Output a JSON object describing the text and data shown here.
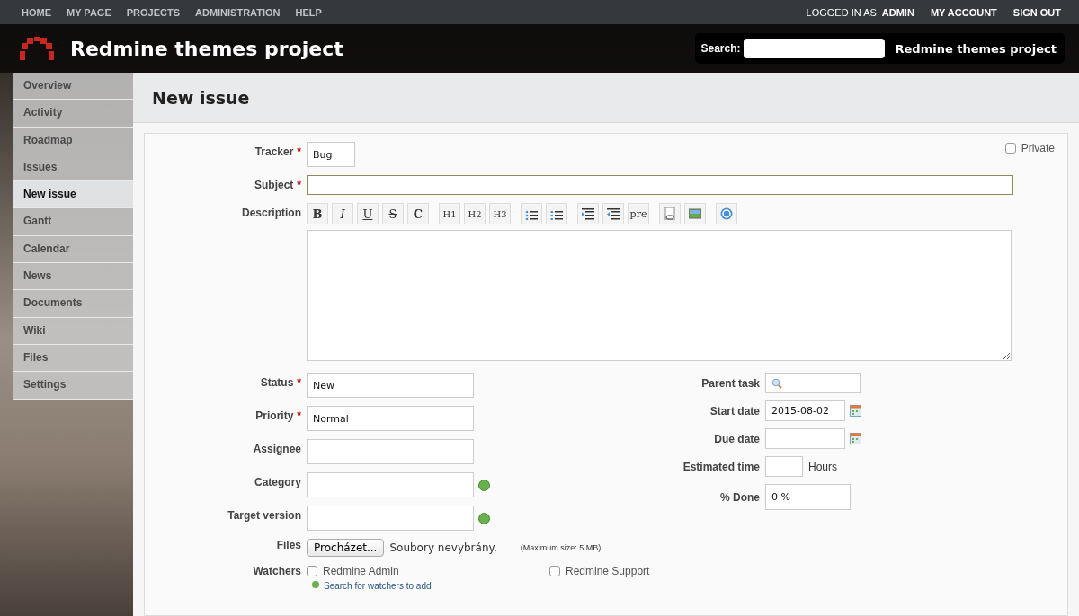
{
  "top_menu": {
    "left": [
      {
        "label": "HOME"
      },
      {
        "label": "MY PAGE"
      },
      {
        "label": "PROJECTS"
      },
      {
        "label": "ADMINISTRATION"
      },
      {
        "label": "HELP"
      }
    ],
    "logged_in_as": "LOGGED IN AS",
    "user": "ADMIN",
    "right": [
      {
        "label": "MY ACCOUNT"
      },
      {
        "label": "SIGN OUT"
      }
    ]
  },
  "header": {
    "title": "Redmine themes project",
    "search_label": "Search:",
    "project_jump": "Redmine themes project"
  },
  "sidebar": {
    "items": [
      {
        "label": "Overview",
        "selected": false
      },
      {
        "label": "Activity",
        "selected": false
      },
      {
        "label": "Roadmap",
        "selected": false
      },
      {
        "label": "Issues",
        "selected": false
      },
      {
        "label": "New issue",
        "selected": true
      },
      {
        "label": "Gantt",
        "selected": false
      },
      {
        "label": "Calendar",
        "selected": false
      },
      {
        "label": "News",
        "selected": false
      },
      {
        "label": "Documents",
        "selected": false
      },
      {
        "label": "Wiki",
        "selected": false
      },
      {
        "label": "Files",
        "selected": false
      },
      {
        "label": "Settings",
        "selected": false
      }
    ]
  },
  "page_title": "New issue",
  "form": {
    "tracker": {
      "label": "Tracker",
      "marker": "*",
      "value": "Bug"
    },
    "private": {
      "label": "Private",
      "checked": false
    },
    "subject": {
      "label": "Subject",
      "marker": "*"
    },
    "description": {
      "label": "Description",
      "toolbar": [
        [
          {
            "kind": "text",
            "label": "B"
          },
          {
            "kind": "text",
            "label": "I"
          },
          {
            "kind": "text",
            "label": "U"
          },
          {
            "kind": "text",
            "label": "S"
          },
          {
            "kind": "text",
            "label": "C"
          }
        ],
        [
          {
            "kind": "text",
            "label": "H1"
          },
          {
            "kind": "text",
            "label": "H2"
          },
          {
            "kind": "text",
            "label": "H3"
          }
        ],
        [
          {
            "kind": "icon"
          },
          {
            "kind": "icon"
          }
        ],
        [
          {
            "kind": "icon"
          },
          {
            "kind": "icon"
          },
          {
            "kind": "text",
            "label": "pre"
          }
        ],
        [
          {
            "kind": "icon"
          },
          {
            "kind": "icon"
          }
        ],
        [
          {
            "kind": "icon"
          }
        ]
      ]
    },
    "left": [
      {
        "label": "Status",
        "marker": "*",
        "value": "New"
      },
      {
        "label": "Priority",
        "marker": "*",
        "value": "Normal"
      },
      {
        "label": "Assignee"
      },
      {
        "label": "Category",
        "add": true
      },
      {
        "label": "Target version",
        "add": true
      }
    ],
    "right": [
      {
        "label": "Parent task",
        "kind": "search"
      },
      {
        "label": "Start date",
        "kind": "date",
        "value": "2015-08-02"
      },
      {
        "label": "Due date",
        "kind": "date"
      },
      {
        "label": "Estimated time",
        "kind": "hours",
        "unit": "Hours"
      },
      {
        "label": "% Done",
        "kind": "select",
        "value": "0 %"
      }
    ],
    "files": {
      "label": "Files",
      "button": "Procházet...",
      "status": "Soubory nevybrány.",
      "note": "(Maximum size: 5 MB)"
    },
    "watchers": {
      "label": "Watchers",
      "items": [
        {
          "label": "Redmine Admin",
          "checked": false
        },
        {
          "label": "Redmine Support",
          "checked": false
        }
      ],
      "search_link": "Search for watchers to add"
    }
  }
}
